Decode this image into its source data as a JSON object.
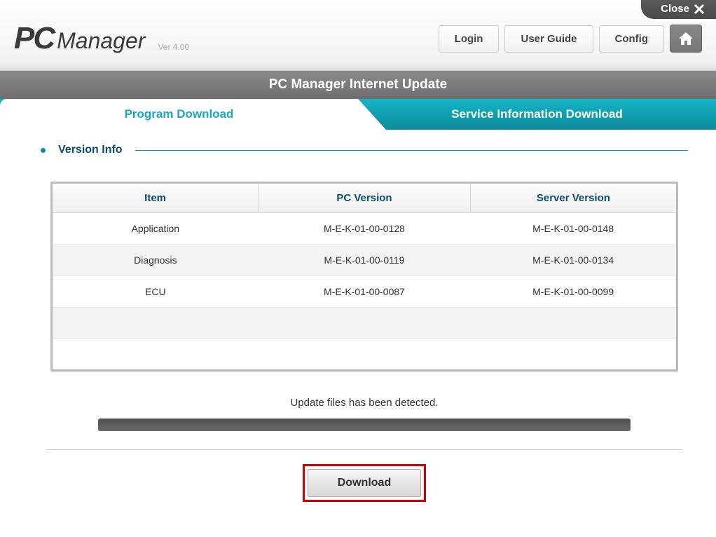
{
  "close_label": "Close",
  "app_name_pc": "PC",
  "app_name_manager": "Manager",
  "version_label": "Ver 4.00",
  "header_buttons": {
    "login": "Login",
    "user_guide": "User Guide",
    "config": "Config"
  },
  "section_title": "PC Manager Internet Update",
  "tabs": {
    "program_download": "Program Download",
    "service_info_download": "Service Information Download"
  },
  "panel": {
    "version_info_label": "Version Info",
    "columns": {
      "item": "Item",
      "pc_version": "PC Version",
      "server_version": "Server Version"
    },
    "rows": [
      {
        "item": "Application",
        "pc": "M-E-K-01-00-0128",
        "server": "M-E-K-01-00-0148"
      },
      {
        "item": "Diagnosis",
        "pc": "M-E-K-01-00-0119",
        "server": "M-E-K-01-00-0134"
      },
      {
        "item": "ECU",
        "pc": "M-E-K-01-00-0087",
        "server": "M-E-K-01-00-0099"
      }
    ],
    "status_text": "Update files has been detected.",
    "download_label": "Download"
  }
}
